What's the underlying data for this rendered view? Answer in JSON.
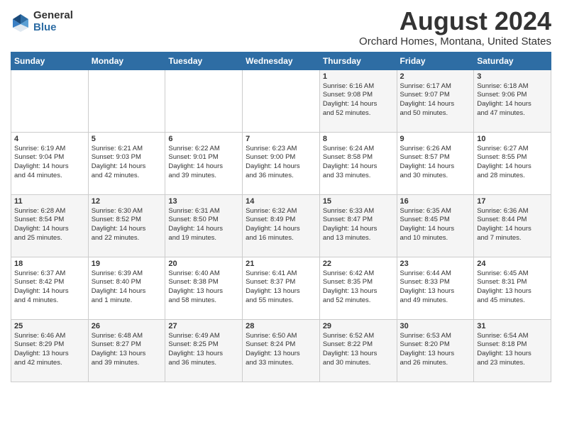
{
  "logo": {
    "general": "General",
    "blue": "Blue"
  },
  "header": {
    "month": "August 2024",
    "location": "Orchard Homes, Montana, United States"
  },
  "days_of_week": [
    "Sunday",
    "Monday",
    "Tuesday",
    "Wednesday",
    "Thursday",
    "Friday",
    "Saturday"
  ],
  "weeks": [
    [
      {
        "day": "",
        "info": ""
      },
      {
        "day": "",
        "info": ""
      },
      {
        "day": "",
        "info": ""
      },
      {
        "day": "",
        "info": ""
      },
      {
        "day": "1",
        "info": "Sunrise: 6:16 AM\nSunset: 9:08 PM\nDaylight: 14 hours\nand 52 minutes."
      },
      {
        "day": "2",
        "info": "Sunrise: 6:17 AM\nSunset: 9:07 PM\nDaylight: 14 hours\nand 50 minutes."
      },
      {
        "day": "3",
        "info": "Sunrise: 6:18 AM\nSunset: 9:06 PM\nDaylight: 14 hours\nand 47 minutes."
      }
    ],
    [
      {
        "day": "4",
        "info": "Sunrise: 6:19 AM\nSunset: 9:04 PM\nDaylight: 14 hours\nand 44 minutes."
      },
      {
        "day": "5",
        "info": "Sunrise: 6:21 AM\nSunset: 9:03 PM\nDaylight: 14 hours\nand 42 minutes."
      },
      {
        "day": "6",
        "info": "Sunrise: 6:22 AM\nSunset: 9:01 PM\nDaylight: 14 hours\nand 39 minutes."
      },
      {
        "day": "7",
        "info": "Sunrise: 6:23 AM\nSunset: 9:00 PM\nDaylight: 14 hours\nand 36 minutes."
      },
      {
        "day": "8",
        "info": "Sunrise: 6:24 AM\nSunset: 8:58 PM\nDaylight: 14 hours\nand 33 minutes."
      },
      {
        "day": "9",
        "info": "Sunrise: 6:26 AM\nSunset: 8:57 PM\nDaylight: 14 hours\nand 30 minutes."
      },
      {
        "day": "10",
        "info": "Sunrise: 6:27 AM\nSunset: 8:55 PM\nDaylight: 14 hours\nand 28 minutes."
      }
    ],
    [
      {
        "day": "11",
        "info": "Sunrise: 6:28 AM\nSunset: 8:54 PM\nDaylight: 14 hours\nand 25 minutes."
      },
      {
        "day": "12",
        "info": "Sunrise: 6:30 AM\nSunset: 8:52 PM\nDaylight: 14 hours\nand 22 minutes."
      },
      {
        "day": "13",
        "info": "Sunrise: 6:31 AM\nSunset: 8:50 PM\nDaylight: 14 hours\nand 19 minutes."
      },
      {
        "day": "14",
        "info": "Sunrise: 6:32 AM\nSunset: 8:49 PM\nDaylight: 14 hours\nand 16 minutes."
      },
      {
        "day": "15",
        "info": "Sunrise: 6:33 AM\nSunset: 8:47 PM\nDaylight: 14 hours\nand 13 minutes."
      },
      {
        "day": "16",
        "info": "Sunrise: 6:35 AM\nSunset: 8:45 PM\nDaylight: 14 hours\nand 10 minutes."
      },
      {
        "day": "17",
        "info": "Sunrise: 6:36 AM\nSunset: 8:44 PM\nDaylight: 14 hours\nand 7 minutes."
      }
    ],
    [
      {
        "day": "18",
        "info": "Sunrise: 6:37 AM\nSunset: 8:42 PM\nDaylight: 14 hours\nand 4 minutes."
      },
      {
        "day": "19",
        "info": "Sunrise: 6:39 AM\nSunset: 8:40 PM\nDaylight: 14 hours\nand 1 minute."
      },
      {
        "day": "20",
        "info": "Sunrise: 6:40 AM\nSunset: 8:38 PM\nDaylight: 13 hours\nand 58 minutes."
      },
      {
        "day": "21",
        "info": "Sunrise: 6:41 AM\nSunset: 8:37 PM\nDaylight: 13 hours\nand 55 minutes."
      },
      {
        "day": "22",
        "info": "Sunrise: 6:42 AM\nSunset: 8:35 PM\nDaylight: 13 hours\nand 52 minutes."
      },
      {
        "day": "23",
        "info": "Sunrise: 6:44 AM\nSunset: 8:33 PM\nDaylight: 13 hours\nand 49 minutes."
      },
      {
        "day": "24",
        "info": "Sunrise: 6:45 AM\nSunset: 8:31 PM\nDaylight: 13 hours\nand 45 minutes."
      }
    ],
    [
      {
        "day": "25",
        "info": "Sunrise: 6:46 AM\nSunset: 8:29 PM\nDaylight: 13 hours\nand 42 minutes."
      },
      {
        "day": "26",
        "info": "Sunrise: 6:48 AM\nSunset: 8:27 PM\nDaylight: 13 hours\nand 39 minutes."
      },
      {
        "day": "27",
        "info": "Sunrise: 6:49 AM\nSunset: 8:25 PM\nDaylight: 13 hours\nand 36 minutes."
      },
      {
        "day": "28",
        "info": "Sunrise: 6:50 AM\nSunset: 8:24 PM\nDaylight: 13 hours\nand 33 minutes."
      },
      {
        "day": "29",
        "info": "Sunrise: 6:52 AM\nSunset: 8:22 PM\nDaylight: 13 hours\nand 30 minutes."
      },
      {
        "day": "30",
        "info": "Sunrise: 6:53 AM\nSunset: 8:20 PM\nDaylight: 13 hours\nand 26 minutes."
      },
      {
        "day": "31",
        "info": "Sunrise: 6:54 AM\nSunset: 8:18 PM\nDaylight: 13 hours\nand 23 minutes."
      }
    ]
  ]
}
